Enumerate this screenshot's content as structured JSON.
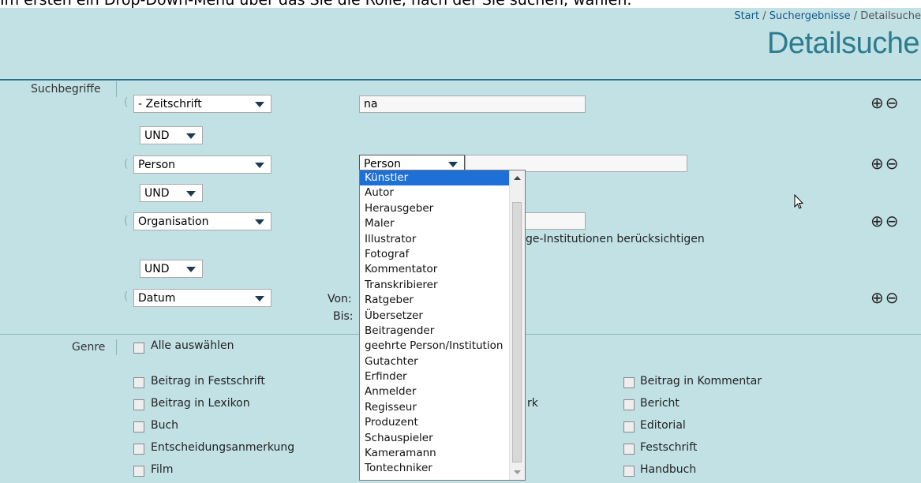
{
  "caption": "Im ersten ein Drop-Down-Menü über das Sie die Rolle, nach der Sie suchen, wählen.",
  "breadcrumb": {
    "start": "Start",
    "results": "Suchergebnisse",
    "current": "Detailsuche",
    "sep": " / "
  },
  "title": "Detailsuche",
  "search": {
    "label": "Suchbegriffe",
    "rows": [
      {
        "field": "- Zeitschrift",
        "value": "na"
      },
      {
        "operator": "UND"
      },
      {
        "field": "Person",
        "role": "Person",
        "value": ""
      },
      {
        "operator": "UND"
      },
      {
        "field": "Organisation",
        "value": "",
        "checkbox_text": "ge-Institutionen berücksichtigen"
      },
      {
        "operator": "UND"
      },
      {
        "field": "Datum",
        "from_label": "Von:",
        "to_label": "Bis:"
      }
    ],
    "plus_icon": "⊕",
    "minus_icon": "⊖"
  },
  "role_dropdown": {
    "items": [
      "Künstler",
      "Autor",
      "Herausgeber",
      "Maler",
      "Illustrator",
      "Fotograf",
      "Kommentator",
      "Transkribierer",
      "Ratgeber",
      "Übersetzer",
      "Beitragender",
      "geehrte Person/Institution",
      "Gutachter",
      "Erfinder",
      "Anmelder",
      "Regisseur",
      "Produzent",
      "Schauspieler",
      "Kameramann",
      "Tontechniker"
    ],
    "selected_index": 0
  },
  "genre": {
    "label": "Genre",
    "select_all": "Alle auswählen",
    "col1": [
      "Beitrag in Festschrift",
      "Beitrag in Lexikon",
      "Buch",
      "Entscheidungsanmerkung",
      "Film"
    ],
    "col2_fragment": "rk",
    "col3": [
      "Beitrag in Kommentar",
      "Bericht",
      "Editorial",
      "Festschrift",
      "Handbuch"
    ]
  }
}
